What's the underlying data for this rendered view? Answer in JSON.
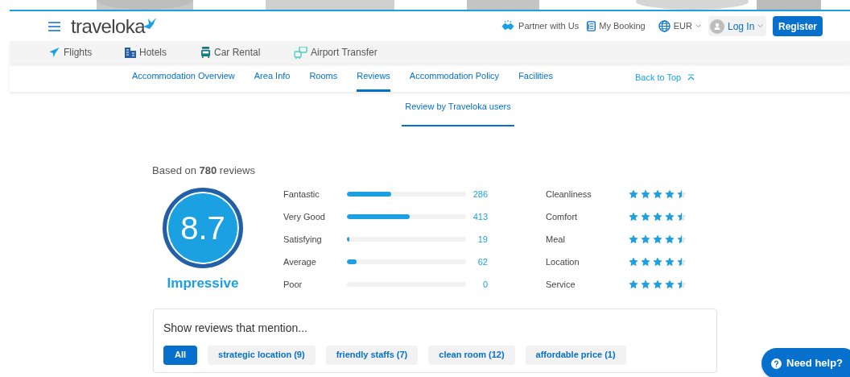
{
  "header": {
    "logo": "traveloka",
    "links": [
      {
        "kind": "partner",
        "label": "Partner with Us"
      },
      {
        "kind": "booking",
        "label": "My Booking"
      },
      {
        "kind": "currency",
        "label": "EUR"
      }
    ],
    "login": "Log In",
    "register": "Register"
  },
  "products": [
    {
      "kind": "flight",
      "label": "Flights"
    },
    {
      "kind": "hotel",
      "label": "Hotels"
    },
    {
      "kind": "car",
      "label": "Car Rental"
    },
    {
      "kind": "transfer",
      "label": "Airport Transfer"
    }
  ],
  "section_tabs": [
    {
      "label": "Accommodation Overview",
      "selected": false
    },
    {
      "label": "Area Info",
      "selected": false
    },
    {
      "label": "Rooms",
      "selected": false
    },
    {
      "label": "Reviews",
      "selected": true
    },
    {
      "label": "Accommodation Policy",
      "selected": false
    },
    {
      "label": "Facilities",
      "selected": false
    }
  ],
  "back_to_top": "Back to Top",
  "review_tab": "Review by Traveloka users",
  "summary": "Based on **780** reviews",
  "score": "8.7",
  "score_label": "Impressive",
  "distribution": [
    {
      "label": "Fantastic",
      "level": 0.37,
      "count": "286"
    },
    {
      "label": "Very Good",
      "level": 0.53,
      "count": "413"
    },
    {
      "label": "Satisfying",
      "level": 0.02,
      "count": "19"
    },
    {
      "label": "Average",
      "level": 0.08,
      "count": "62"
    },
    {
      "label": "Poor",
      "level": 0,
      "count": "0"
    }
  ],
  "aspects": [
    {
      "label": "Cleanliness",
      "stars": 4.5
    },
    {
      "label": "Comfort",
      "stars": 4.5
    },
    {
      "label": "Meal",
      "stars": 4.5
    },
    {
      "label": "Location",
      "stars": 4.5
    },
    {
      "label": "Service",
      "stars": 4.5
    }
  ],
  "mentions": {
    "title": "Show reviews that mention...",
    "filters": [
      {
        "label": "All",
        "selected": true
      },
      {
        "label": "strategic location (9)",
        "selected": false
      },
      {
        "label": "friendly staffs (7)",
        "selected": false
      },
      {
        "label": "clean room (12)",
        "selected": false
      },
      {
        "label": "affordable price (1)",
        "selected": false
      }
    ]
  },
  "help_button": "Need help?"
}
